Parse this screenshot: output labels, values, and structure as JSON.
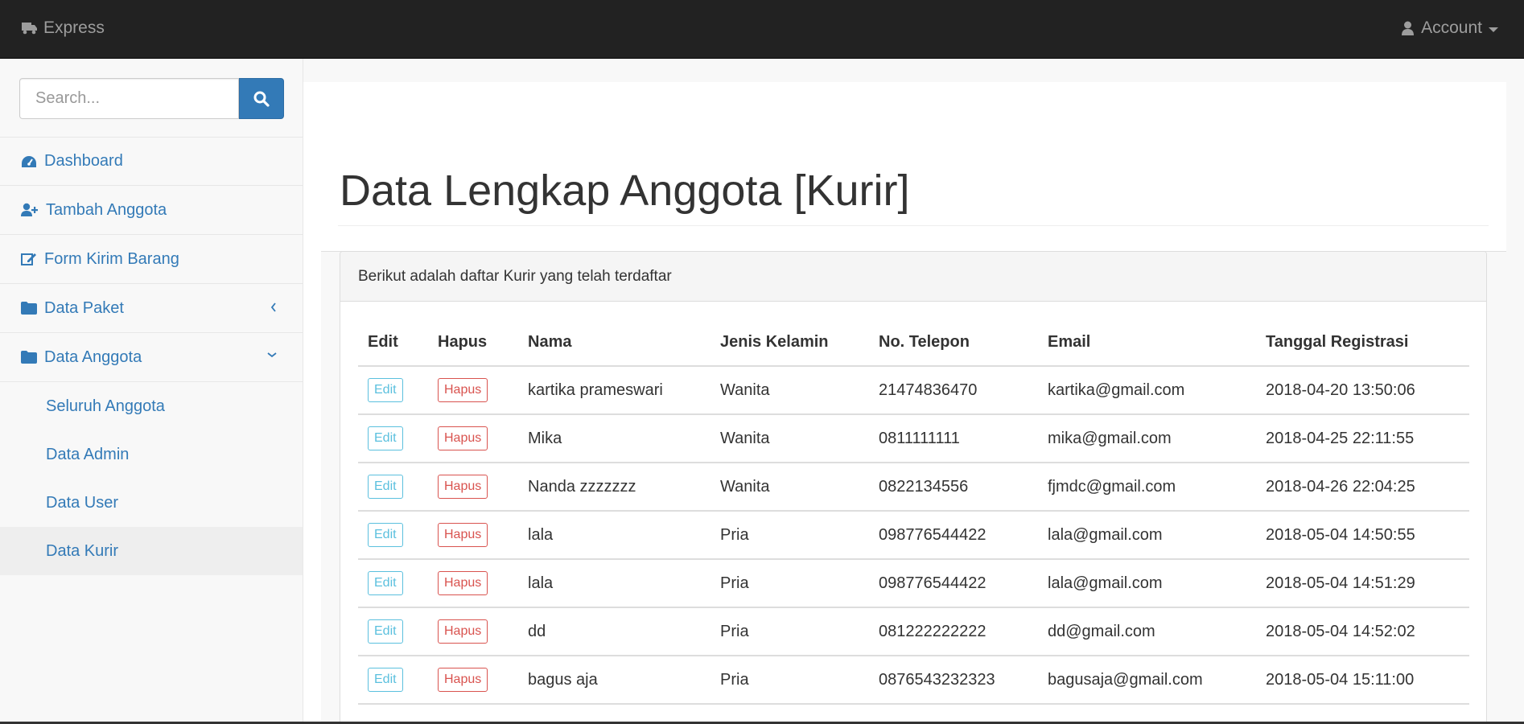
{
  "colors": {
    "navbar_bg": "#222222",
    "link": "#337ab7",
    "edit_button": "#5bc0de",
    "hapus_button": "#d9534f",
    "active_sidebar_bg": "#eeeeee"
  },
  "navbar": {
    "brand_icon": "truck-icon",
    "brand": "Express",
    "account_icon": "user-icon",
    "account": "Account"
  },
  "sidebar": {
    "search_placeholder": "Search...",
    "search_icon": "search-icon",
    "items": [
      {
        "label": "Dashboard",
        "icon": "dashboard-icon"
      },
      {
        "label": "Tambah Anggota",
        "icon": "user-plus-icon"
      },
      {
        "label": "Form Kirim Barang",
        "icon": "edit-icon"
      },
      {
        "label": "Data Paket",
        "icon": "folder-icon",
        "arrow": "chevron-left-icon"
      },
      {
        "label": "Data Anggota",
        "icon": "folder-icon",
        "arrow": "chevron-down-icon"
      }
    ],
    "subitems": [
      {
        "label": "Seluruh Anggota"
      },
      {
        "label": "Data Admin"
      },
      {
        "label": "Data User"
      },
      {
        "label": "Data Kurir",
        "active": true
      }
    ]
  },
  "main": {
    "title": "Data Lengkap Anggota [Kurir]",
    "panel_heading": "Berikut adalah daftar Kurir yang telah terdaftar",
    "table": {
      "headers": [
        "Edit",
        "Hapus",
        "Nama",
        "Jenis Kelamin",
        "No. Telepon",
        "Email",
        "Tanggal Registrasi"
      ],
      "edit_label": "Edit",
      "hapus_label": "Hapus",
      "rows": [
        [
          "kartika prameswari",
          "Wanita",
          "21474836470",
          "kartika@gmail.com",
          "2018-04-20 13:50:06"
        ],
        [
          "Mika",
          "Wanita",
          "0811111111",
          "mika@gmail.com",
          "2018-04-25 22:11:55"
        ],
        [
          "Nanda zzzzzzz",
          "Wanita",
          "0822134556",
          "fjmdc@gmail.com",
          "2018-04-26 22:04:25"
        ],
        [
          "lala",
          "Pria",
          "098776544422",
          "lala@gmail.com",
          "2018-05-04 14:50:55"
        ],
        [
          "lala",
          "Pria",
          "098776544422",
          "lala@gmail.com",
          "2018-05-04 14:51:29"
        ],
        [
          "dd",
          "Pria",
          "081222222222",
          "dd@gmail.com",
          "2018-05-04 14:52:02"
        ],
        [
          "bagus aja",
          "Pria",
          "0876543232323",
          "bagusaja@gmail.com",
          "2018-05-04 15:11:00"
        ]
      ]
    }
  }
}
